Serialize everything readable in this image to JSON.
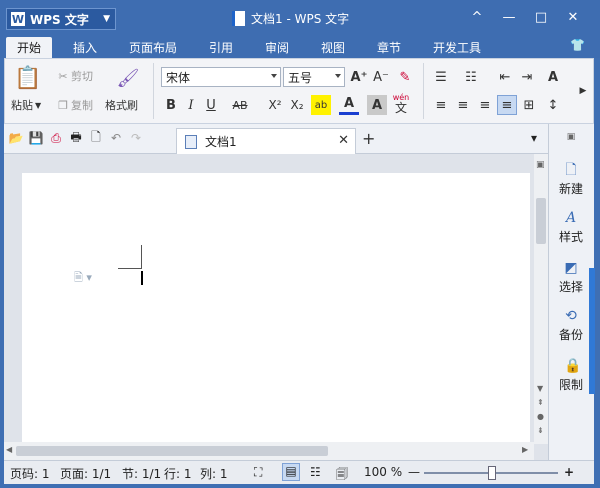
{
  "app": {
    "name": "WPS 文字",
    "window_title": "文档1 - WPS 文字"
  },
  "window_controls": {
    "collapse": "^",
    "minimize": "—",
    "maximize": "□",
    "close": "✕"
  },
  "menu": {
    "tabs": [
      "开始",
      "插入",
      "页面布局",
      "引用",
      "审阅",
      "视图",
      "章节",
      "开发工具"
    ],
    "active": "开始"
  },
  "ribbon": {
    "paste": "粘贴",
    "cut": "剪切",
    "copy": "复制",
    "format_painter": "格式刷",
    "font_name": "宋体",
    "font_size": "五号",
    "bold": "B",
    "italic": "I",
    "underline": "U",
    "strike": "AB",
    "superscript": "X²",
    "subscript": "X₂",
    "grow_font": "A⁺",
    "shrink_font": "A⁻",
    "wen": "wén",
    "wen_char": "文"
  },
  "doc_tab": {
    "name": "文档1",
    "close": "✕",
    "new": "+"
  },
  "side_panel": [
    "新建",
    "样式",
    "选择",
    "备份",
    "限制"
  ],
  "status": {
    "page_no": "页码: 1",
    "pages": "页面: 1/1",
    "section": "节: 1/1",
    "row": "行: 1",
    "col": "列: 1",
    "zoom": "100 %",
    "zoom_out": "—",
    "zoom_in": "+"
  },
  "zoom_level": 100,
  "colors": {
    "title_bar": "#3e6db1",
    "accent_blue": "#3079d6",
    "ribbon_bg": "#f3f4f7"
  }
}
